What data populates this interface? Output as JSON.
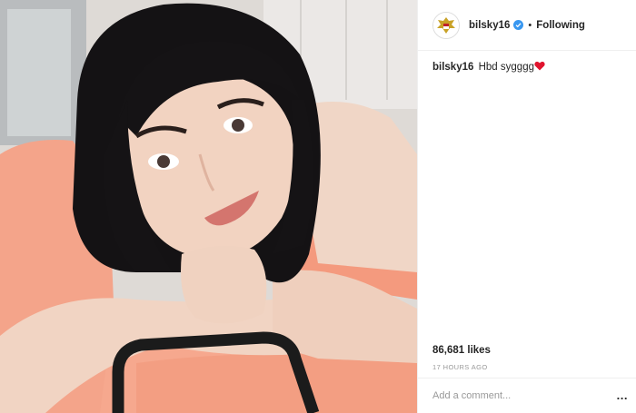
{
  "post": {
    "username": "bilsky16",
    "separator": "•",
    "follow_status": "Following",
    "caption_user": "bilsky16",
    "caption_text": "Hbd sygggg",
    "likes": "86,681 likes",
    "timestamp": "17 HOURS AGO",
    "comment_placeholder": "Add a comment...",
    "more_label": "..."
  },
  "icons": {
    "avatar": "garuda-emblem-avatar",
    "verified": "verified-badge-icon",
    "heart": "red-heart-emoji",
    "more": "more-options-icon"
  },
  "colors": {
    "verified_blue": "#3897f0",
    "heart_red": "#e0142e",
    "muted_text": "#999999"
  }
}
